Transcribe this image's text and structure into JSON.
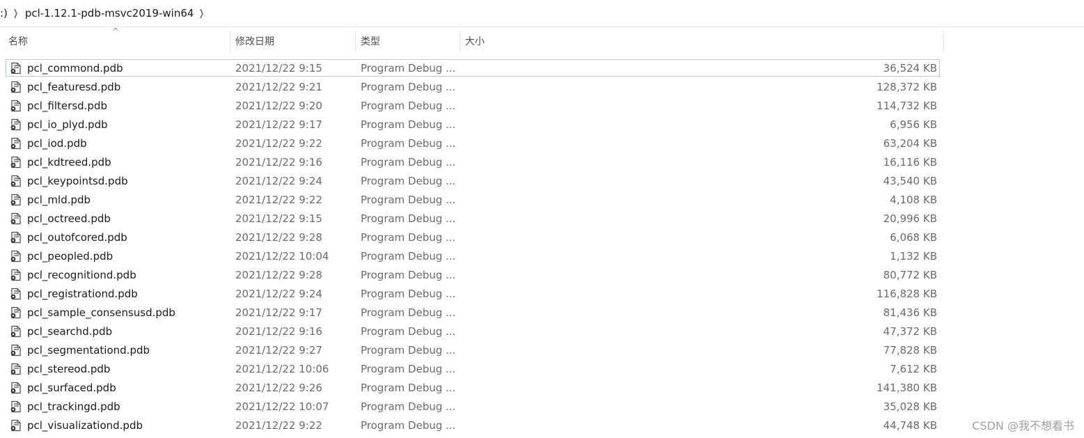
{
  "breadcrumb": {
    "drive": ":)",
    "folder": "pcl-1.12.1-pdb-msvc2019-win64"
  },
  "columns": {
    "name": "名称",
    "date": "修改日期",
    "type": "类型",
    "size": "大小",
    "sort_indicator": "^"
  },
  "files": [
    {
      "name": "pcl_commond.pdb",
      "date": "2021/12/22 9:15",
      "type": "Program Debug ...",
      "size": "36,524 KB",
      "selected": true
    },
    {
      "name": "pcl_featuresd.pdb",
      "date": "2021/12/22 9:21",
      "type": "Program Debug ...",
      "size": "128,372 KB"
    },
    {
      "name": "pcl_filtersd.pdb",
      "date": "2021/12/22 9:20",
      "type": "Program Debug ...",
      "size": "114,732 KB"
    },
    {
      "name": "pcl_io_plyd.pdb",
      "date": "2021/12/22 9:17",
      "type": "Program Debug ...",
      "size": "6,956 KB"
    },
    {
      "name": "pcl_iod.pdb",
      "date": "2021/12/22 9:22",
      "type": "Program Debug ...",
      "size": "63,204 KB"
    },
    {
      "name": "pcl_kdtreed.pdb",
      "date": "2021/12/22 9:16",
      "type": "Program Debug ...",
      "size": "16,116 KB"
    },
    {
      "name": "pcl_keypointsd.pdb",
      "date": "2021/12/22 9:24",
      "type": "Program Debug ...",
      "size": "43,540 KB"
    },
    {
      "name": "pcl_mld.pdb",
      "date": "2021/12/22 9:22",
      "type": "Program Debug ...",
      "size": "4,108 KB"
    },
    {
      "name": "pcl_octreed.pdb",
      "date": "2021/12/22 9:15",
      "type": "Program Debug ...",
      "size": "20,996 KB"
    },
    {
      "name": "pcl_outofcored.pdb",
      "date": "2021/12/22 9:28",
      "type": "Program Debug ...",
      "size": "6,068 KB"
    },
    {
      "name": "pcl_peopled.pdb",
      "date": "2021/12/22 10:04",
      "type": "Program Debug ...",
      "size": "1,132 KB"
    },
    {
      "name": "pcl_recognitiond.pdb",
      "date": "2021/12/22 9:28",
      "type": "Program Debug ...",
      "size": "80,772 KB"
    },
    {
      "name": "pcl_registrationd.pdb",
      "date": "2021/12/22 9:24",
      "type": "Program Debug ...",
      "size": "116,828 KB"
    },
    {
      "name": "pcl_sample_consensusd.pdb",
      "date": "2021/12/22 9:17",
      "type": "Program Debug ...",
      "size": "81,436 KB"
    },
    {
      "name": "pcl_searchd.pdb",
      "date": "2021/12/22 9:16",
      "type": "Program Debug ...",
      "size": "47,372 KB"
    },
    {
      "name": "pcl_segmentationd.pdb",
      "date": "2021/12/22 9:27",
      "type": "Program Debug ...",
      "size": "77,828 KB"
    },
    {
      "name": "pcl_stereod.pdb",
      "date": "2021/12/22 10:06",
      "type": "Program Debug ...",
      "size": "7,612 KB"
    },
    {
      "name": "pcl_surfaced.pdb",
      "date": "2021/12/22 9:26",
      "type": "Program Debug ...",
      "size": "141,380 KB"
    },
    {
      "name": "pcl_trackingd.pdb",
      "date": "2021/12/22 10:07",
      "type": "Program Debug ...",
      "size": "35,028 KB"
    },
    {
      "name": "pcl_visualizationd.pdb",
      "date": "2021/12/22 9:22",
      "type": "Program Debug ...",
      "size": "44,748 KB"
    }
  ],
  "file_icon": "pdb-file-icon",
  "watermark": "CSDN @我不想看书",
  "colors": {
    "selection_border": "#99d1ff",
    "secondary_text": "#6b6b6b"
  }
}
